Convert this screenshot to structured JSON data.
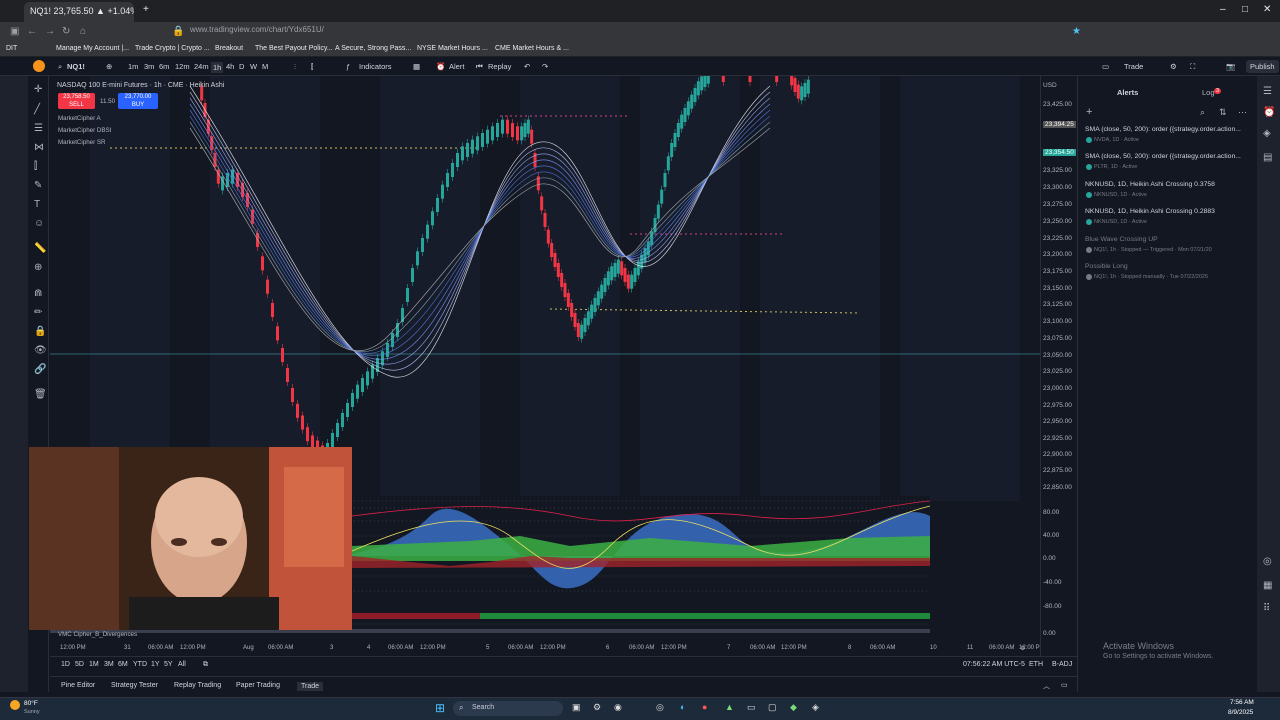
{
  "browser": {
    "tab_title": "NQ1! 23,765.50 ▲ +1.04% Tradi",
    "url": "www.tradingview.com/chart/Ydx651U/",
    "bookmarks": [
      "Manage My Account |...",
      "Trade Crypto | Crypto ...",
      "Breakout",
      "The Best Payout Policy...",
      "A Secure, Strong Pass...",
      "NYSE Market Hours ...",
      "CME Market Hours & ..."
    ],
    "bookmark_left": "DIT"
  },
  "toolbar": {
    "symbol": "NQ1!",
    "intervals": [
      "1m",
      "3m",
      "6m",
      "12m",
      "24m",
      "1h",
      "4h",
      "D",
      "W",
      "M"
    ],
    "active_interval": "1h",
    "indicators_label": "Indicators",
    "alert_label": "Alert",
    "replay_label": "Replay",
    "trade_label": "Trade",
    "publish_label": "Publish"
  },
  "legend": {
    "title": "NASDAQ 100 E-mini Futures · 1h · CME · Heikin Ashi",
    "sell_price": "23,758.50",
    "sell_label": "SELL",
    "spread": "11.50",
    "buy_price": "23,770.00",
    "buy_label": "BUY",
    "indicators": [
      "MarketCipher A",
      "MarketCipher DBSI",
      "MarketCipher SR"
    ],
    "sub_indicator": "VMC Cipher_B_Divergences"
  },
  "price_scale": {
    "currency": "USD",
    "labels": [
      "23,425.00",
      "23,394.25",
      "23,354.50",
      "23,325.00",
      "23,300.00",
      "23,275.00",
      "23,250.00",
      "23,225.00",
      "23,200.00",
      "23,175.00",
      "23,150.00",
      "23,125.00",
      "23,100.00",
      "23,075.00",
      "23,050.00",
      "23,025.00",
      "23,000.00",
      "22,975.00",
      "22,950.00",
      "22,925.00",
      "22,900.00",
      "22,875.00",
      "22,850.00"
    ],
    "osc_labels": [
      "80.00",
      "40.00",
      "0.00",
      "-40.00",
      "-80.00",
      "0.00"
    ]
  },
  "time_axis": {
    "labels": [
      "12:00 PM",
      "31",
      "06:00 AM",
      "12:00 PM",
      "Aug",
      "06:00 AM",
      "3",
      "4",
      "06:00 AM",
      "12:00 PM",
      "5",
      "06:00 AM",
      "12:00 PM",
      "6",
      "06:00 AM",
      "12:00 PM",
      "7",
      "06:00 AM",
      "12:00 PM",
      "8",
      "06:00 AM",
      "10",
      "11",
      "06:00 AM",
      "12:00 P"
    ],
    "clock": "07:56:22 AM UTC-5",
    "session": "ETH",
    "adj": "B-ADJ"
  },
  "range_buttons": [
    "1D",
    "5D",
    "1M",
    "3M",
    "6M",
    "YTD",
    "1Y",
    "5Y",
    "All"
  ],
  "bottom_panel": [
    "Pine Editor",
    "Strategy Tester",
    "Replay Trading",
    "Paper Trading",
    "Trade"
  ],
  "alerts_panel": {
    "tab_alerts": "Alerts",
    "tab_log": "Log",
    "log_count": "3",
    "items": [
      {
        "title": "SMA (close, 50, 200): order {{strategy.order.action...",
        "sub": "NVDA, 1D · Active",
        "status": "active"
      },
      {
        "title": "SMA (close, 50, 200): order {{strategy.order.action...",
        "sub": "PLTR, 1D · Active",
        "status": "active"
      },
      {
        "title": "NKNUSD, 1D, Heikin Ashi Crossing 0.3758",
        "sub": "NKNUSD, 1D · Active",
        "status": "active"
      },
      {
        "title": "NKNUSD, 1D, Heikin Ashi Crossing 0.2883",
        "sub": "NKNUSD, 1D · Active",
        "status": "active"
      },
      {
        "title": "Blue Wave Crossing UP",
        "sub": "NQ1!, 1h · Stopped — Triggered · Mon 07/21/20",
        "status": "triggered"
      },
      {
        "title": "Possible Long",
        "sub": "NQ1!, 1h · Stopped manually · Tue 07/22/2025",
        "status": "stopped"
      }
    ]
  },
  "watermark": {
    "line1": "Activate Windows",
    "line2": "Go to Settings to activate Windows."
  },
  "taskbar": {
    "weather_temp": "80°F",
    "weather_desc": "Sunny",
    "search": "Search",
    "time": "7:56 AM",
    "date": "8/9/2025"
  },
  "colors": {
    "bull": "#26a69a",
    "bear": "#f23645",
    "accent": "#2962ff",
    "bg": "#131722"
  }
}
